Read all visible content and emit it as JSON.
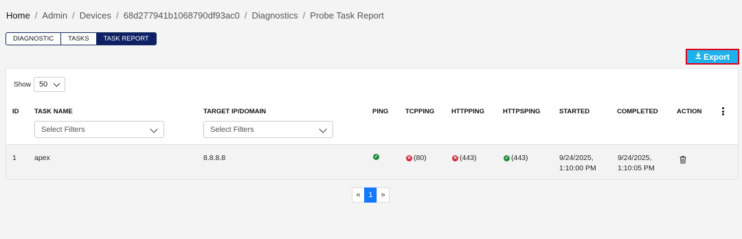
{
  "breadcrumb": [
    "Home",
    "Admin",
    "Devices",
    "68d277941b1068790df93ac0",
    "Diagnostics",
    "Probe Task Report"
  ],
  "tabs": {
    "diagnostic": "DIAGNOSTIC",
    "tasks": "TASKS",
    "report": "TASK REPORT",
    "active": "TASK REPORT"
  },
  "export": {
    "label": "Export",
    "icon": "download-icon"
  },
  "show": {
    "label": "Show",
    "value": "50"
  },
  "table": {
    "headers": {
      "id": "ID",
      "task_name": "TASK NAME",
      "target": "TARGET IP/DOMAIN",
      "ping": "PING",
      "tcpping": "TCPPING",
      "httpping": "HTTPPING",
      "httpsping": "HTTPSPING",
      "started": "STARTED",
      "completed": "COMPLETED",
      "action": "ACTION"
    },
    "filter_placeholder": "Select Filters",
    "rows": [
      {
        "id": "1",
        "task_name": "apex",
        "target": "8.8.8.8",
        "ping": {
          "status": "success",
          "text": ""
        },
        "tcpping": {
          "status": "error",
          "text": "(80)"
        },
        "httpping": {
          "status": "error",
          "text": "(443)"
        },
        "httpsping": {
          "status": "success",
          "text": "(443)"
        },
        "started": {
          "date": "9/24/2025,",
          "time": "1:10:00 PM"
        },
        "completed": {
          "date": "9/24/2025,",
          "time": "1:10:05 PM"
        }
      }
    ]
  },
  "pagination": {
    "prev": "«",
    "current": "1",
    "next": "»"
  },
  "colors": {
    "accent": "#1eb2ec",
    "tab_active": "#0f2166",
    "success": "#1e8a3a",
    "error": "#d02a3c",
    "page_active": "#1479ff"
  }
}
